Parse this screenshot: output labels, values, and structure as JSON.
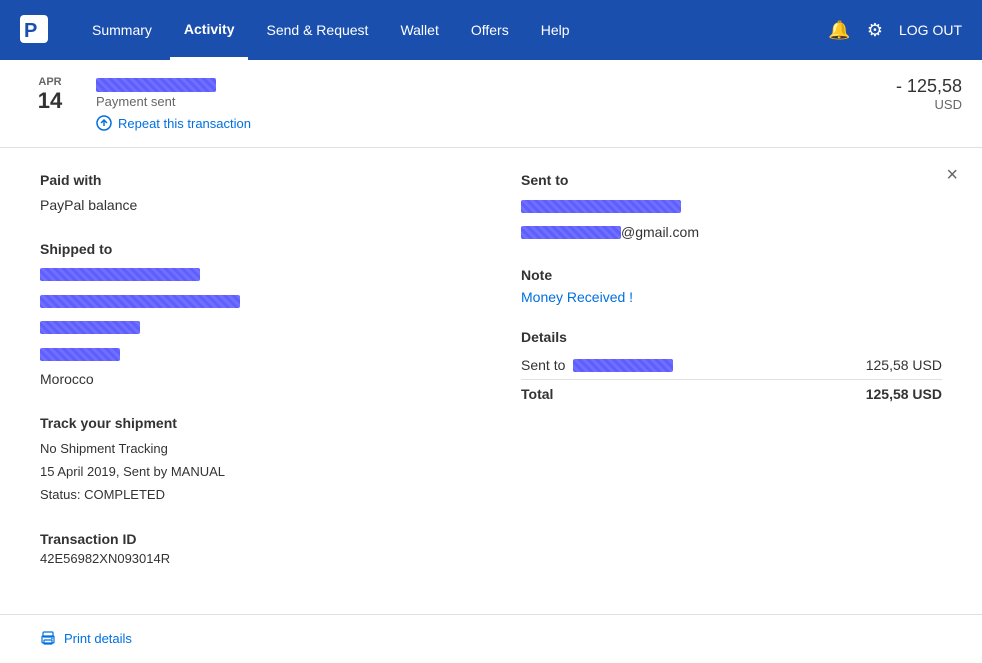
{
  "header": {
    "logo_label": "PayPal",
    "nav": [
      {
        "id": "summary",
        "label": "Summary",
        "active": false
      },
      {
        "id": "activity",
        "label": "Activity",
        "active": true
      },
      {
        "id": "send-request",
        "label": "Send & Request",
        "active": false
      },
      {
        "id": "wallet",
        "label": "Wallet",
        "active": false
      },
      {
        "id": "offers",
        "label": "Offers",
        "active": false
      },
      {
        "id": "help",
        "label": "Help",
        "active": false
      }
    ],
    "logout_label": "LOG OUT"
  },
  "transaction": {
    "date_month": "APR",
    "date_day": "14",
    "status": "Payment sent",
    "repeat_label": "Repeat this transaction",
    "amount": "- 125,58",
    "currency": "USD"
  },
  "detail": {
    "close_icon": "×",
    "paid_with_label": "Paid with",
    "paid_with_value": "PayPal balance",
    "shipped_to_label": "Shipped to",
    "shipped_line1": "[REDACTED NAME]",
    "shipped_line2": "[REDACTED ADDRESS]",
    "shipped_line3": "[REDACTED]",
    "shipped_line4": "[REDACTED]",
    "shipped_country": "Morocco",
    "track_label": "Track your shipment",
    "track_no_shipment": "No Shipment Tracking",
    "track_date": "15 April 2019, Sent by MANUAL",
    "track_status": "Status: COMPLETED",
    "txn_id_label": "Transaction ID",
    "txn_id": "42E56982XN093014R",
    "sent_to_label": "Sent to",
    "sent_to_name": "[REDACTED NAME]",
    "sent_to_email": "[REDACTED]@gmail.com",
    "note_label": "Note",
    "note_value": "Money Received !",
    "details_label": "Details",
    "details_sent_to_label": "Sent to",
    "details_amount": "125,58 USD",
    "total_label": "Total",
    "total_amount": "125,58 USD",
    "print_label": "Print details"
  }
}
